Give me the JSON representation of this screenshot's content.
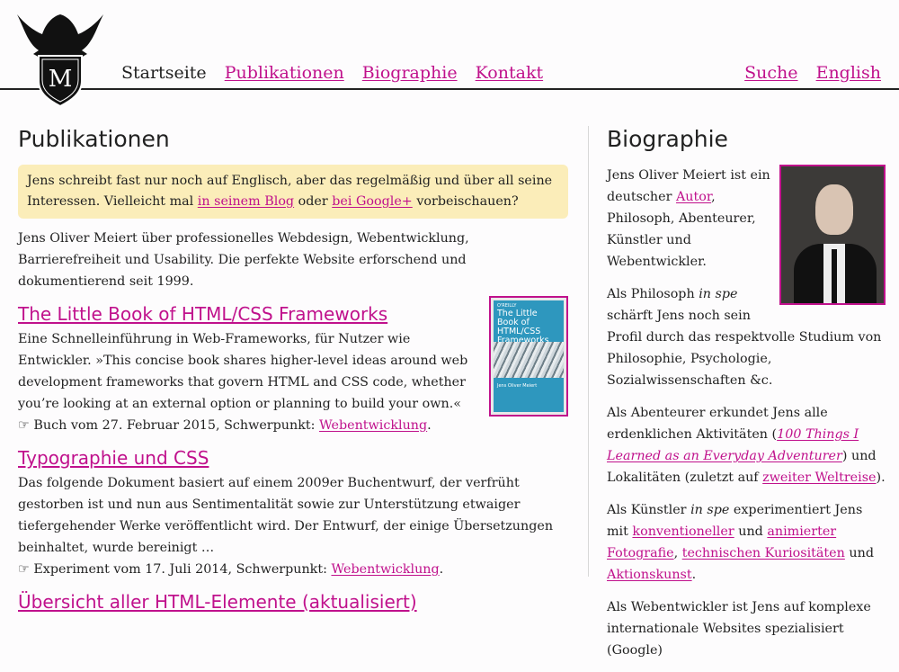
{
  "nav": {
    "items": [
      "Startseite",
      "Publikationen",
      "Biographie",
      "Kontakt"
    ],
    "right": [
      "Suche",
      "English"
    ]
  },
  "main": {
    "title": "Publikationen",
    "notice": {
      "text1": "Jens schreibt fast nur noch auf Englisch, aber das regelmäßig und über all seine Interessen. Vielleicht mal ",
      "link1": "in seinem Blog",
      "text2": " oder ",
      "link2": "bei Google+",
      "text3": " vorbeischauen?"
    },
    "intro": "Jens Oliver Meiert über professionelles Webdesign, Webentwicklung, Barrierefreiheit und Usability. Die perfekte Website erforschend und dokumentierend seit 1999.",
    "publications": [
      {
        "title": "The Little Book of HTML/CSS Frameworks",
        "description": "Eine Schnelleinführung in Web-Frameworks, für Nutzer wie Entwickler. »This concise book shares higher-level ideas around web development frameworks that govern HTML and CSS code, whether you’re looking at an external option or planning to build your own.«",
        "hand": "☞",
        "meta": " Buch vom 27. Februar 2015, Schwerpunkt: ",
        "topic": "Webentwicklung",
        "after": "."
      },
      {
        "title": "Typographie und CSS",
        "description": "Das folgende Dokument basiert auf einem 2009er Buchentwurf, der verfrüht gestorben ist und nun aus Sentimentalität sowie zur Unterstützung etwaiger tiefergehender Werke veröffentlicht wird. Der Entwurf, der einige Übersetzungen beinhaltet, wurde bereinigt …",
        "hand": "☞",
        "meta": " Experiment vom 17. Juli 2014, Schwerpunkt: ",
        "topic": "Webentwicklung",
        "after": "."
      },
      {
        "title": "Übersicht aller HTML-Elemente (aktualisiert)"
      }
    ],
    "book": {
      "brand": "O'REILLY",
      "title": "The Little Book of HTML/CSS Frameworks",
      "author": "Jens Oliver Meiert"
    }
  },
  "aside": {
    "title": "Biographie",
    "p1": {
      "a": "Jens Oliver Meiert ist ein deutscher ",
      "link": "Autor",
      "b": ", Philosoph, Abenteurer, Künstler und Webentwickler."
    },
    "p2": {
      "a": "Als Philosoph ",
      "em": "in spe",
      "b": " schärft Jens noch sein Profil durch das respektvolle Studium von Philosophie, Psychologie, Sozialwissenschaften &c."
    },
    "p3": {
      "a": "Als Abenteurer erkundet Jens alle erdenklichen Aktivitäten (",
      "link1": "100 Things I Learned as an Everyday Adventurer",
      "b": ") und Lokalitäten (zuletzt auf ",
      "link2": "zweiter Weltreise",
      "c": ")."
    },
    "p4": {
      "a": "Als Künstler ",
      "em": "in spe",
      "b": " experimentiert Jens mit ",
      "link1": "konventioneller",
      "c": " und ",
      "link2": "animierter Fotografie",
      "d": ", ",
      "link3": "technischen Kuriositäten",
      "e": " und ",
      "link4": "Aktionskunst",
      "f": "."
    },
    "p5": {
      "a": "Als Webentwickler ist Jens auf komplexe internationale Websites spezialisiert (Google)"
    }
  },
  "colors": {
    "link": "#c0118c",
    "notice_bg": "#fbedb9"
  },
  "icons": [
    "eagle-shield-logo",
    "pointing-hand-icon"
  ]
}
